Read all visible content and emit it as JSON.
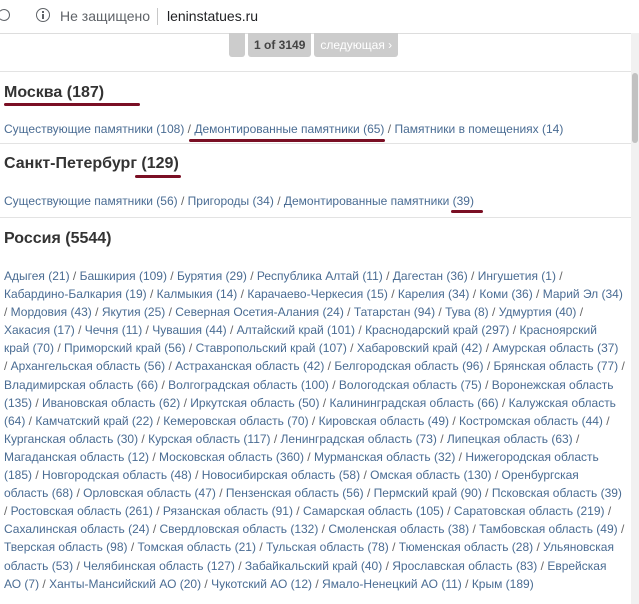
{
  "browser": {
    "security_label": "Не защищено",
    "url": "leninstatues.ru"
  },
  "pager": {
    "page_label": "1 of 3149",
    "next_label": "следующая ›"
  },
  "sections": {
    "moscow": {
      "title": "Москва (187)",
      "links": [
        "Существующие памятники (108)",
        "Демонтированные памятники (65)",
        "Памятники в помещениях (14)"
      ]
    },
    "spb": {
      "title": "Санкт-Петербург (129)",
      "links": [
        "Существующие памятники (56)",
        "Пригороды (34)",
        "Демонтированные памятники (39)"
      ]
    },
    "russia": {
      "title": "Россия (5544)",
      "regions": [
        "Адыгея (21)",
        "Башкирия (109)",
        "Бурятия (29)",
        "Республика Алтай (11)",
        "Дагестан (36)",
        "Ингушетия (1)",
        "Кабардино-Балкария (19)",
        "Калмыкия (14)",
        "Карачаево-Черкесия (15)",
        "Карелия (34)",
        "Коми (36)",
        "Марий Эл (34)",
        "Мордовия (43)",
        "Якутия (25)",
        "Северная Осетия-Алания (24)",
        "Татарстан (94)",
        "Тува (8)",
        "Удмуртия (40)",
        "Хакасия (17)",
        "Чечня (11)",
        "Чувашия (44)",
        "Алтайский край (101)",
        "Краснодарский край (297)",
        "Красноярский край (70)",
        "Приморский край (56)",
        "Ставропольский край (107)",
        "Хабаровский край (42)",
        "Амурская область (37)",
        "Архангельская область (56)",
        "Астраханская область (42)",
        "Белгородская область (96)",
        "Брянская область (77)",
        "Владимирская область (66)",
        "Волгоградская область (100)",
        "Вологодская область (75)",
        "Воронежская область (135)",
        "Ивановская область (62)",
        "Иркутская область (50)",
        "Калининградская область (66)",
        "Калужская область (64)",
        "Камчатский край (22)",
        "Кемеровская область (70)",
        "Кировская область (49)",
        "Костромская область (44)",
        "Курганская область (30)",
        "Курская область (117)",
        "Ленинградская область (73)",
        "Липецкая область (63)",
        "Магаданская область (12)",
        "Московская область (360)",
        "Мурманская область (32)",
        "Нижегородская область (185)",
        "Новгородская область (48)",
        "Новосибирская область (58)",
        "Омская область (130)",
        "Оренбургская область (68)",
        "Орловская область (47)",
        "Пензенская область (56)",
        "Пермский край (90)",
        "Псковская область (39)",
        "Ростовская область (261)",
        "Рязанская область (91)",
        "Самарская область (105)",
        "Саратовская область (219)",
        "Сахалинская область (24)",
        "Свердловская область (132)",
        "Смоленская область (38)",
        "Тамбовская область (49)",
        "Тверская область (98)",
        "Томская область (21)",
        "Тульская область (78)",
        "Тюменская область (28)",
        "Ульяновская область (53)",
        "Челябинская область (127)",
        "Забайкальский край (40)",
        "Ярославская область (83)",
        "Еврейская АО (7)",
        "Ханты-Мансийский АО (20)",
        "Чукотский АО (12)",
        "Ямало-Ненецкий АО (11)",
        "Крым (189)"
      ]
    }
  },
  "colors": {
    "link": "#4a6c93",
    "annotation_mark": "#7a0f24",
    "separator": "#666666"
  },
  "icons": [
    "info-icon",
    "reload-icon"
  ]
}
